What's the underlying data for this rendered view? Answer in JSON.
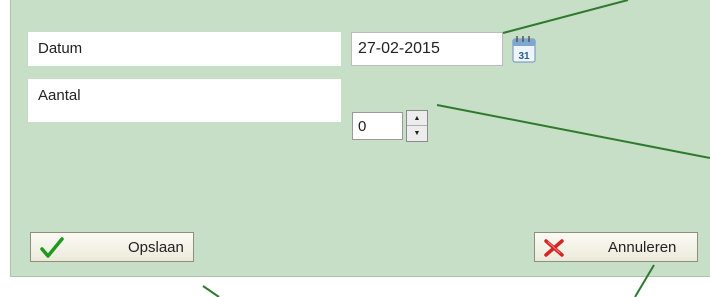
{
  "form": {
    "date_label": "Datum",
    "date_value": "27-02-2015",
    "amount_label": "Aantal",
    "amount_value": "0"
  },
  "buttons": {
    "save_label": "Opslaan",
    "cancel_label": "Annuleren"
  },
  "icons": {
    "calendar": "calendar-icon",
    "save": "checkmark-icon",
    "cancel": "red-x-icon",
    "spin_up": "arrow-up-icon",
    "spin_down": "arrow-down-icon"
  },
  "calendar_icon_text": "31",
  "colors": {
    "panel_background": "#c6dfc6",
    "annotation_line": "#2f7a2f",
    "checkmark": "#1f9a1f",
    "cancel_x": "#d42424"
  }
}
